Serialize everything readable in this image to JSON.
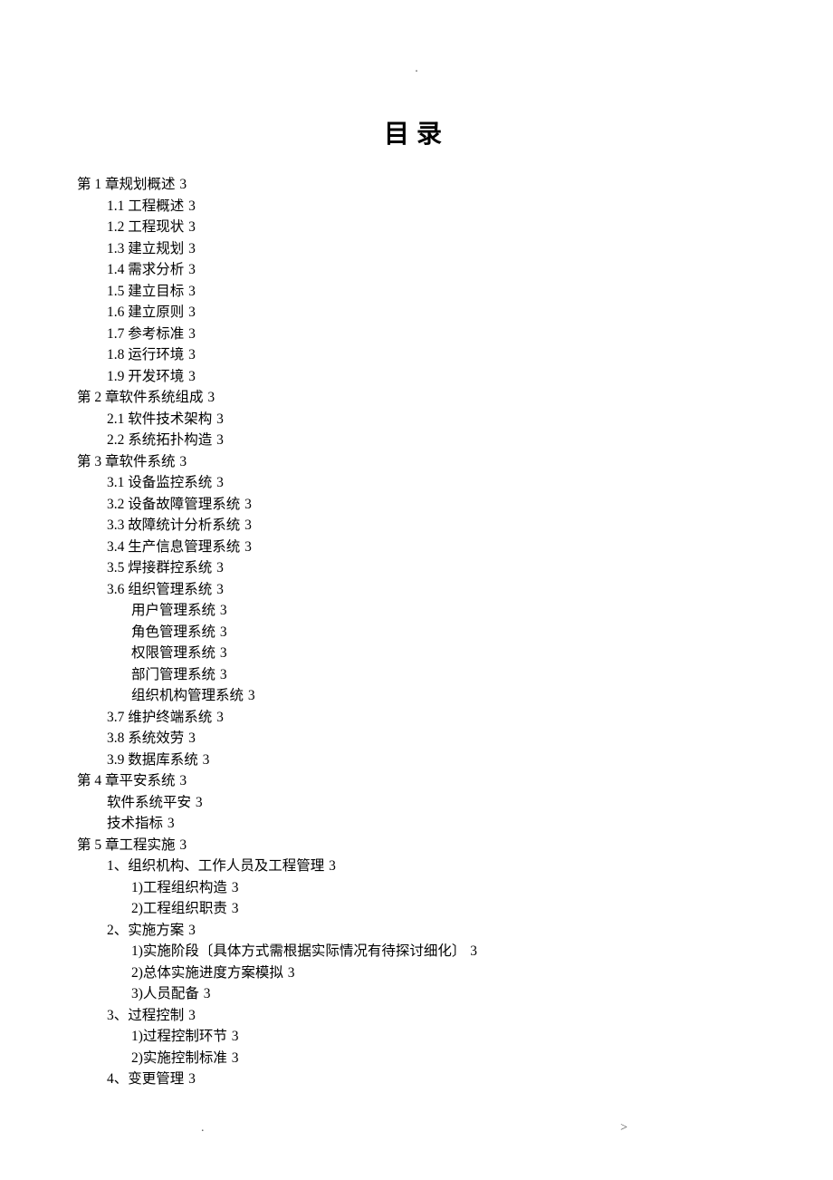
{
  "title": "目录",
  "top_marker": ".",
  "footer_left": ".",
  "footer_right": ">",
  "toc": [
    {
      "level": 0,
      "label": "第 1 章规划概述",
      "page": "3"
    },
    {
      "level": 1,
      "label": "1.1 工程概述",
      "page": "3"
    },
    {
      "level": 1,
      "label": "1.2 工程现状",
      "page": "3"
    },
    {
      "level": 1,
      "label": "1.3 建立规划",
      "page": "3"
    },
    {
      "level": 1,
      "label": "1.4 需求分析",
      "page": "3"
    },
    {
      "level": 1,
      "label": "1.5 建立目标",
      "page": "3"
    },
    {
      "level": 1,
      "label": "1.6 建立原则",
      "page": "3"
    },
    {
      "level": 1,
      "label": "1.7 参考标准",
      "page": "3"
    },
    {
      "level": 1,
      "label": "1.8 运行环境",
      "page": "3"
    },
    {
      "level": 1,
      "label": "1.9 开发环境",
      "page": "3"
    },
    {
      "level": 0,
      "label": "第 2 章软件系统组成",
      "page": "3"
    },
    {
      "level": 1,
      "label": "2.1 软件技术架构",
      "page": "3"
    },
    {
      "level": 1,
      "label": "2.2 系统拓扑构造",
      "page": "3"
    },
    {
      "level": 0,
      "label": "第 3 章软件系统",
      "page": "3"
    },
    {
      "level": 1,
      "label": "3.1 设备监控系统",
      "page": "3"
    },
    {
      "level": 1,
      "label": "3.2 设备故障管理系统",
      "page": "3"
    },
    {
      "level": 1,
      "label": "3.3 故障统计分析系统",
      "page": "3"
    },
    {
      "level": 1,
      "label": "3.4 生产信息管理系统",
      "page": "3"
    },
    {
      "level": 1,
      "label": "3.5 焊接群控系统",
      "page": "3"
    },
    {
      "level": 1,
      "label": "3.6 组织管理系统",
      "page": "3"
    },
    {
      "level": 2,
      "label": "用户管理系统",
      "page": "3"
    },
    {
      "level": 2,
      "label": "角色管理系统",
      "page": "3"
    },
    {
      "level": 2,
      "label": "权限管理系统",
      "page": "3"
    },
    {
      "level": 2,
      "label": "部门管理系统",
      "page": "3"
    },
    {
      "level": 2,
      "label": "组织机构管理系统",
      "page": "3"
    },
    {
      "level": 1,
      "label": "3.7 维护终端系统",
      "page": "3"
    },
    {
      "level": 1,
      "label": "3.8 系统效劳",
      "page": "3"
    },
    {
      "level": 1,
      "label": "3.9 数据库系统",
      "page": "3"
    },
    {
      "level": 0,
      "label": "第 4 章平安系统",
      "page": "3"
    },
    {
      "level": 1,
      "label": "软件系统平安",
      "page": "3"
    },
    {
      "level": 1,
      "label": "技术指标",
      "page": "3"
    },
    {
      "level": 0,
      "label": "第 5 章工程实施",
      "page": "3"
    },
    {
      "level": 1,
      "label": "1、组织机构、工作人员及工程管理",
      "page": "3"
    },
    {
      "level": 2,
      "label": "1)工程组织构造",
      "page": "3"
    },
    {
      "level": 2,
      "label": "2)工程组织职责",
      "page": "3"
    },
    {
      "level": 1,
      "label": "2、实施方案",
      "page": "3"
    },
    {
      "level": 2,
      "label": "1)实施阶段〔具体方式需根据实际情况有待探讨细化〕",
      "page": "3"
    },
    {
      "level": 2,
      "label": "2)总体实施进度方案模拟",
      "page": "3"
    },
    {
      "level": 2,
      "label": "3)人员配备",
      "page": "3"
    },
    {
      "level": 1,
      "label": "3、过程控制",
      "page": "3"
    },
    {
      "level": 2,
      "label": "1)过程控制环节",
      "page": "3"
    },
    {
      "level": 2,
      "label": "2)实施控制标准",
      "page": "3"
    },
    {
      "level": 1,
      "label": "4、变更管理",
      "page": "3"
    }
  ]
}
